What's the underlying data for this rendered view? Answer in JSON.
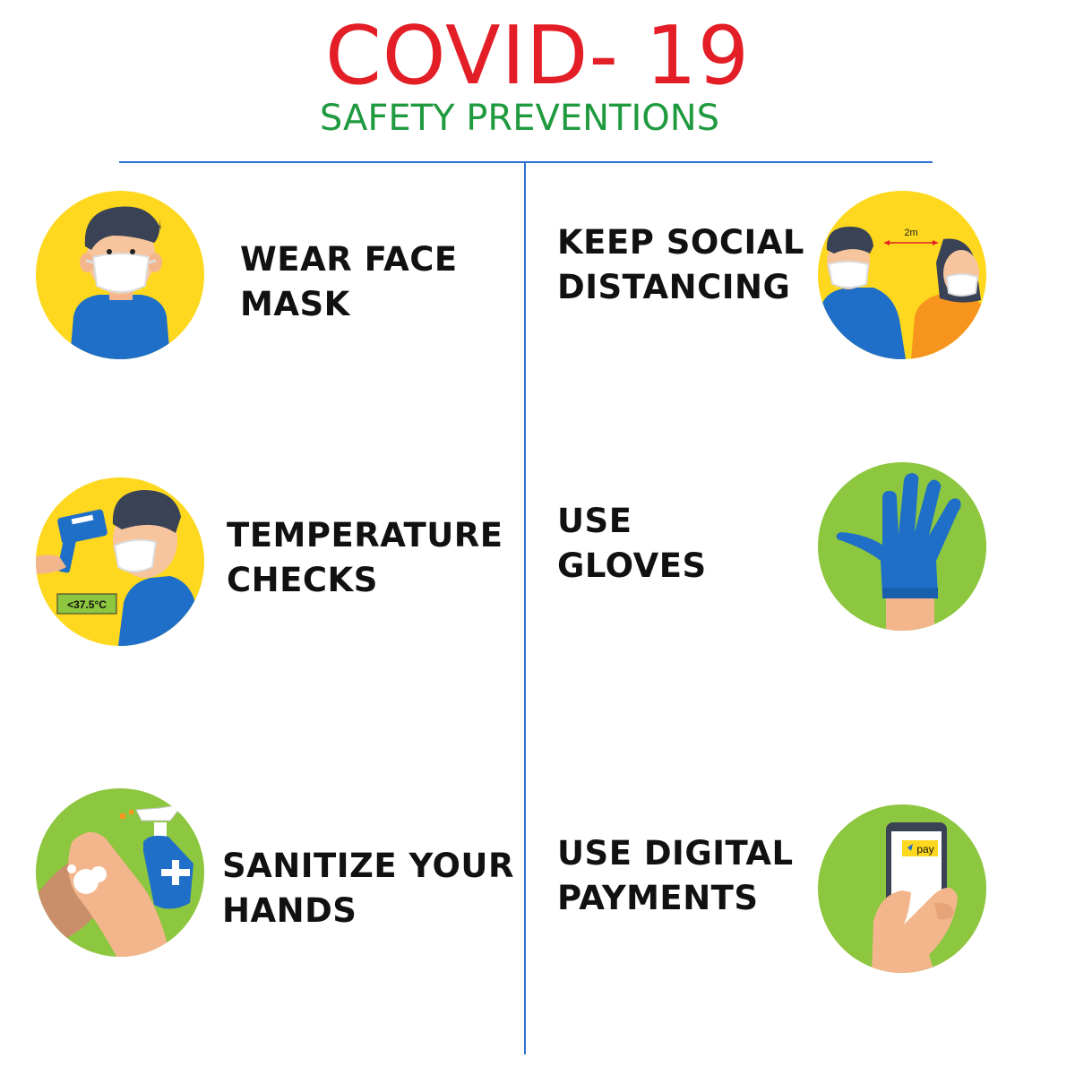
{
  "header": {
    "title": "COVID- 19",
    "subtitle": "SAFETY PREVENTIONS"
  },
  "colors": {
    "title": "#e31e26",
    "subtitle": "#1f9a3f",
    "divider": "#2f6fcf",
    "yellow_circle": "#fdd81e",
    "green_circle": "#8dc63f"
  },
  "items": [
    {
      "icon": "masked-man-icon",
      "line1": "WEAR FACE",
      "line2": "MASK"
    },
    {
      "icon": "social-distance-icon",
      "line1": "KEEP SOCIAL",
      "line2": "DISTANCING",
      "distance_label": "2m"
    },
    {
      "icon": "thermometer-check-icon",
      "line1": "TEMPERATURE",
      "line2": "CHECKS",
      "temp_label": "<37.5°C"
    },
    {
      "icon": "glove-icon",
      "line1": "USE",
      "line2": "GLOVES"
    },
    {
      "icon": "sanitizer-hands-icon",
      "line1": "SANITIZE YOUR",
      "line2": "HANDS"
    },
    {
      "icon": "phone-payment-icon",
      "line1": "USE DIGITAL",
      "line2": "PAYMENTS",
      "pay_label": "pay"
    }
  ]
}
